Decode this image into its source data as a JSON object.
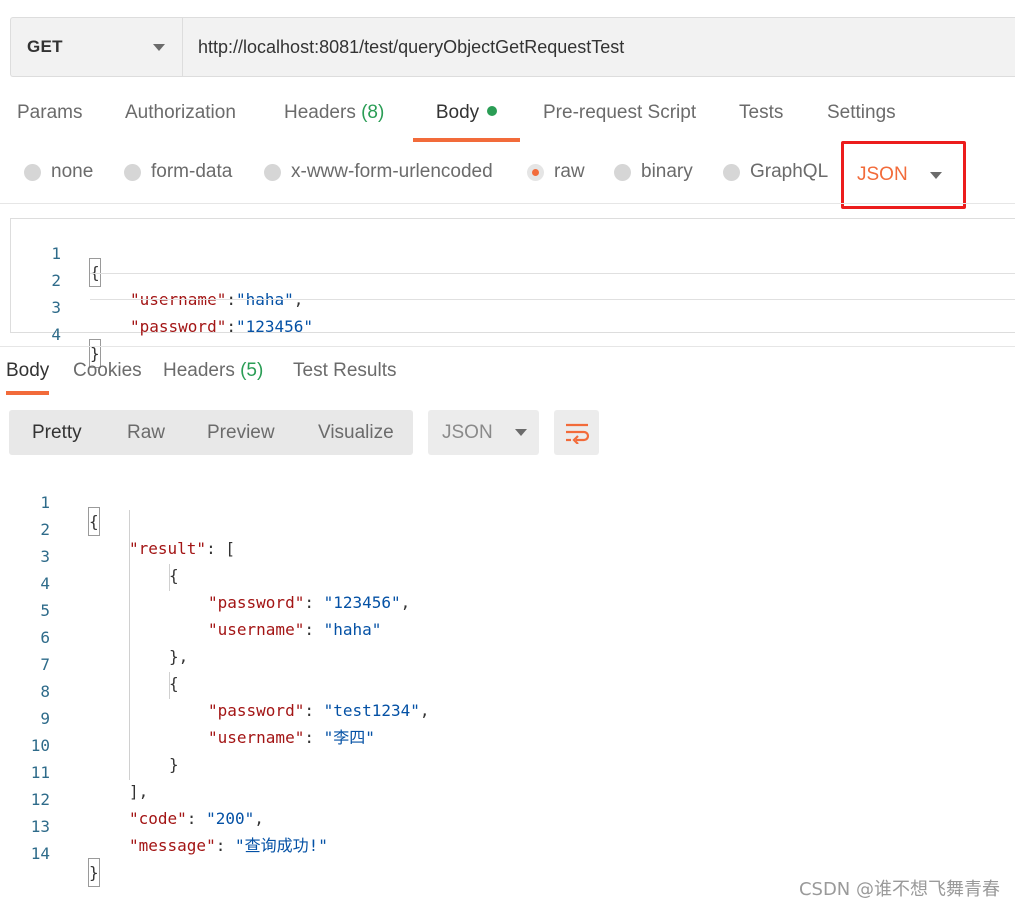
{
  "request": {
    "method": "GET",
    "url": "http://localhost:8081/test/queryObjectGetRequestTest"
  },
  "request_tabs": {
    "params": "Params",
    "authorization": "Authorization",
    "headers": "Headers",
    "headers_count": "(8)",
    "body": "Body",
    "pre_request": "Pre-request Script",
    "tests": "Tests",
    "settings": "Settings"
  },
  "body_types": {
    "none": "none",
    "form_data": "form-data",
    "urlencoded": "x-www-form-urlencoded",
    "raw": "raw",
    "binary": "binary",
    "graphql": "GraphQL",
    "selected": "raw",
    "format": "JSON"
  },
  "request_body": {
    "line_numbers": [
      "1",
      "2",
      "3",
      "4"
    ],
    "open": "{",
    "k1": "\"username\"",
    "sep1": ":",
    "v1": "\"haha\"",
    "comma1": ",",
    "k2": "\"password\"",
    "sep2": ":",
    "v2": "\"123456\"",
    "close": "}"
  },
  "response_tabs": {
    "body": "Body",
    "cookies": "Cookies",
    "headers": "Headers",
    "headers_count": "(5)",
    "test_results": "Test Results"
  },
  "response_toolbar": {
    "pretty": "Pretty",
    "raw": "Raw",
    "preview": "Preview",
    "visualize": "Visualize",
    "format": "JSON",
    "wrap_icon": "wrap-lines-icon"
  },
  "response_body": {
    "line_numbers": [
      "1",
      "2",
      "3",
      "4",
      "5",
      "6",
      "7",
      "8",
      "9",
      "10",
      "11",
      "12",
      "13",
      "14"
    ],
    "l1": "{",
    "result_key": "\"result\"",
    "result_sep": ": [",
    "obj_open": "{",
    "pw_key": "\"password\"",
    "colon": ": ",
    "pw1": "\"123456\"",
    "comma": ",",
    "un_key": "\"username\"",
    "un1": "\"haha\"",
    "obj_close_comma": "},",
    "pw2": "\"test1234\"",
    "un2": "\"李四\"",
    "obj_close": "}",
    "arr_close": "],",
    "code_key": "\"code\"",
    "code_val": "\"200\"",
    "msg_key": "\"message\"",
    "msg_val": "\"查询成功!\"",
    "l14": "}"
  },
  "watermark": "CSDN @谁不想飞舞青春",
  "colors": {
    "accent": "#f26b3a",
    "count_green": "#2a9d55",
    "highlight_box": "#ec1c1c",
    "json_key": "#a31515",
    "json_value": "#0451a5",
    "line_number": "#2e6b8a"
  }
}
